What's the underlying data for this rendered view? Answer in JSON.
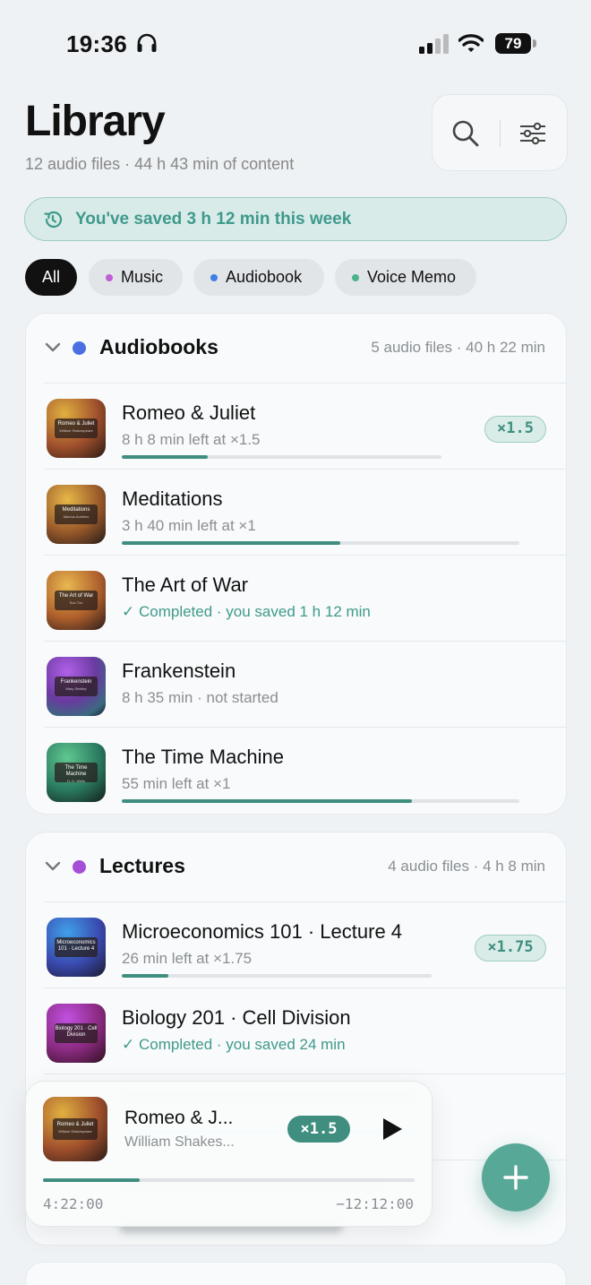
{
  "status_bar": {
    "time": "19:36",
    "battery": "79"
  },
  "header": {
    "title": "Library",
    "subtitle": "12 audio files · 44 h 43 min of content"
  },
  "saved_banner": {
    "text": "You've saved 3 h 12 min this week"
  },
  "filters": {
    "all": "All",
    "music": "Music",
    "audiobook": "Audiobook",
    "voice_memo": "Voice Memo",
    "music_color": "#c05fd6",
    "audiobook_color": "#3f7fe6",
    "voice_memo_color": "#4bb38a"
  },
  "sections": [
    {
      "title": "Audiobooks",
      "meta": "5 audio files · 40 h 22 min",
      "dot_color": "#4a6fe3",
      "items": [
        {
          "title": "Romeo & Juliet",
          "subtitle": "8 h 8 min left at ×1.5",
          "progress": 0.27,
          "speed": "×1.5",
          "cover_title": "Romeo & Juliet",
          "cover_author": "William Shakespeare"
        },
        {
          "title": "Meditations",
          "subtitle": "3 h 40 min left at ×1",
          "progress": 0.55,
          "cover_title": "Meditations",
          "cover_author": "Marcus Aurelius"
        },
        {
          "title": "The Art of War",
          "subtitle": "✓ Completed · you saved 1 h 12 min",
          "completed": true,
          "cover_title": "The Art of War",
          "cover_author": "Sun Tzu"
        },
        {
          "title": "Frankenstein",
          "subtitle": "8 h 35 min · not started",
          "cover_title": "Frankenstein",
          "cover_author": "Mary Shelley"
        },
        {
          "title": "The Time Machine",
          "subtitle": "55 min left at ×1",
          "progress": 0.73,
          "cover_title": "The Time Machine",
          "cover_author": "H. G. Wells"
        }
      ]
    },
    {
      "title": "Lectures",
      "meta": "4 audio files · 4 h 8 min",
      "dot_color": "#a44fd6",
      "items": [
        {
          "title": "Microeconomics 101 · Lecture 4",
          "subtitle": "26 min left at ×1.75",
          "progress": 0.15,
          "speed": "×1.75",
          "cover_title": "Microeconomics 101 · Lecture 4"
        },
        {
          "title": "Biology 201 · Cell Division",
          "subtitle": "✓ Completed · you saved 24 min",
          "completed": true,
          "cover_title": "Biology 201 · Cell Division"
        }
      ]
    }
  ],
  "mini_player": {
    "title": "Romeo & J...",
    "artist": "William Shakes...",
    "speed": "×1.5",
    "elapsed": "4:22:00",
    "remaining": "−12:12:00",
    "progress": 0.26,
    "cover_title": "Romeo & Juliet",
    "cover_author": "William Shakespeare"
  },
  "accent_color": "#3f8e80"
}
